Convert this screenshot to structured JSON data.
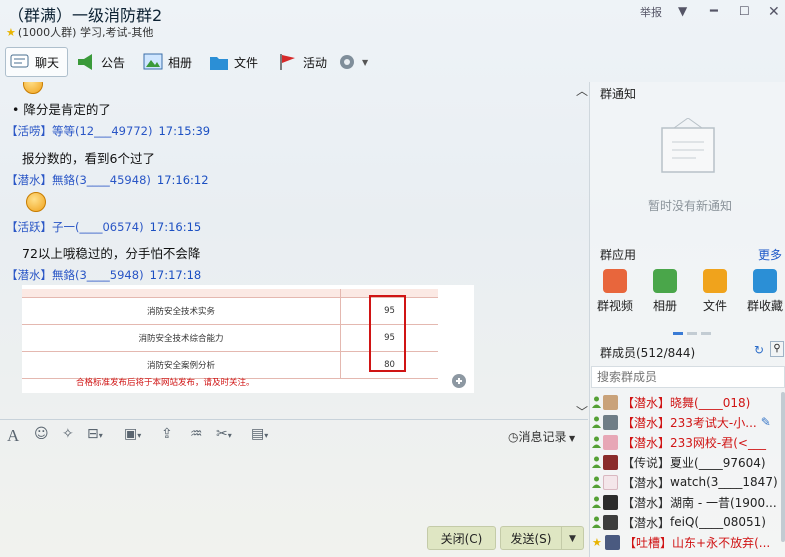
{
  "window": {
    "title": "（群满）一级消防群2",
    "subtitle": "(1000人群) 学习,考试-其他",
    "report_label": "举报"
  },
  "toolbar": {
    "chat": "聊天",
    "announce": "公告",
    "album": "相册",
    "files": "文件",
    "activity": "活动"
  },
  "messages": [
    {
      "type": "text",
      "body": "降分是肯定的了"
    },
    {
      "type": "head",
      "tag": "【活唠】",
      "name": "等等(12___49772)",
      "time": "17:15:39"
    },
    {
      "type": "text",
      "body": "报分数的，看到6个过了"
    },
    {
      "type": "head",
      "tag": "【潜水】",
      "name": "無鉻(3____45948)",
      "time": "17:16:12"
    },
    {
      "type": "head",
      "tag": "【活跃】",
      "name": "子一(____06574)",
      "time": "17:16:15"
    },
    {
      "type": "text",
      "body": "72以上哦稳过的，分手怕不会降"
    },
    {
      "type": "head",
      "tag": "【潜水】",
      "name": "無鉻(3____5948)",
      "time": "17:17:18"
    }
  ],
  "score_image": {
    "rows": [
      {
        "subject": "消防安全技术实务",
        "score": "95"
      },
      {
        "subject": "消防安全技术综合能力",
        "score": "95"
      },
      {
        "subject": "消防安全案例分析",
        "score": "80"
      }
    ],
    "note": "合格标准发布后将于本网站发布，请及时关注。"
  },
  "input": {
    "history_label": "消息记录",
    "close_label": "关闭(C)",
    "send_label": "发送(S)"
  },
  "panel": {
    "notice_title": "群通知",
    "notice_empty": "暂时没有新通知",
    "apps_title": "群应用",
    "apps_more": "更多",
    "apps": [
      "群视频",
      "相册",
      "文件",
      "群收藏"
    ],
    "members_title": "群成员(512/844)",
    "search_placeholder": "搜索群成员",
    "members": [
      {
        "tag": "【潜水】",
        "name": "晓舞(____018)",
        "red": true
      },
      {
        "tag": "【潜水】",
        "name": "233考试大-小...",
        "red": true
      },
      {
        "tag": "【潜水】",
        "name": "233网校-君(<___",
        "red": true
      },
      {
        "tag": "【传说】",
        "name": "夏业(____97604)",
        "red": false
      },
      {
        "tag": "【潜水】",
        "name": "watch(3____1847)",
        "red": false
      },
      {
        "tag": "【潜水】",
        "name": "湖南 - 一昔(1900...",
        "red": false
      },
      {
        "tag": "【潜水】",
        "name": "feiQ(____08051)",
        "red": false
      },
      {
        "tag": "【吐槽】",
        "name": "山东+永不放弃(...",
        "red": true
      }
    ]
  },
  "colors": {
    "link_blue": "#2a56c6",
    "highlight_red": "#d01414",
    "button_bg": "#dfe6c3"
  }
}
